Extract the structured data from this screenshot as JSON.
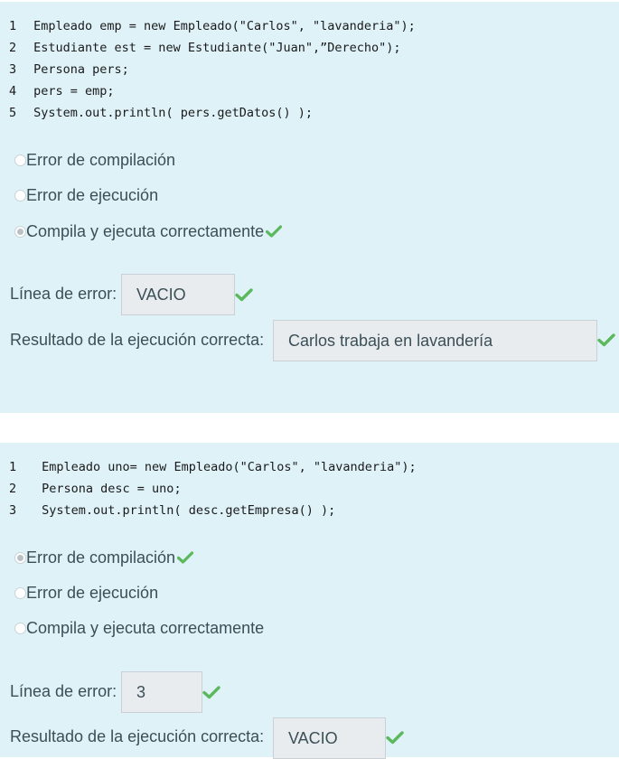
{
  "questions": [
    {
      "code_lines": [
        {
          "n": "1",
          "text": "Empleado emp = new Empleado(\"Carlos\", \"lavanderia\");"
        },
        {
          "n": "2",
          "text": "Estudiante est = new Estudiante(\"Juan\",”Derecho\");"
        },
        {
          "n": "3",
          "text": "Persona pers;"
        },
        {
          "n": "4",
          "text": "pers = emp;"
        },
        {
          "n": "5",
          "text": "System.out.println( pers.getDatos() );"
        }
      ],
      "options": [
        {
          "label": "Error de compilación",
          "selected": false,
          "correct": false
        },
        {
          "label": "Error de ejecución",
          "selected": false,
          "correct": false
        },
        {
          "label": "Compila y ejecuta correctamente",
          "selected": true,
          "correct": true
        }
      ],
      "error_line_label": "Línea de error:",
      "error_line_value": "VACIO",
      "result_label": "Resultado de la ejecución correcta:",
      "result_value": "Carlos trabaja en lavandería"
    },
    {
      "code_lines": [
        {
          "n": "1",
          "text": "Empleado uno= new Empleado(\"Carlos\", \"lavanderia\");"
        },
        {
          "n": "2",
          "text": "Persona desc = uno;"
        },
        {
          "n": "3",
          "text": "System.out.println( desc.getEmpresa() );"
        }
      ],
      "options": [
        {
          "label": "Error de compilación",
          "selected": true,
          "correct": true
        },
        {
          "label": "Error de ejecución",
          "selected": false,
          "correct": false
        },
        {
          "label": "Compila y ejecuta correctamente",
          "selected": false,
          "correct": false
        }
      ],
      "error_line_label": "Línea de error:",
      "error_line_value": "3",
      "result_label": "Resultado de la ejecución correcta:",
      "result_value": "VACIO"
    }
  ],
  "colors": {
    "panel_bg": "#def2f8",
    "check_green": "#5cb85c",
    "text": "#3b4f57"
  },
  "icons": {
    "correct": "checkmark-icon",
    "radio": "radio-button"
  }
}
